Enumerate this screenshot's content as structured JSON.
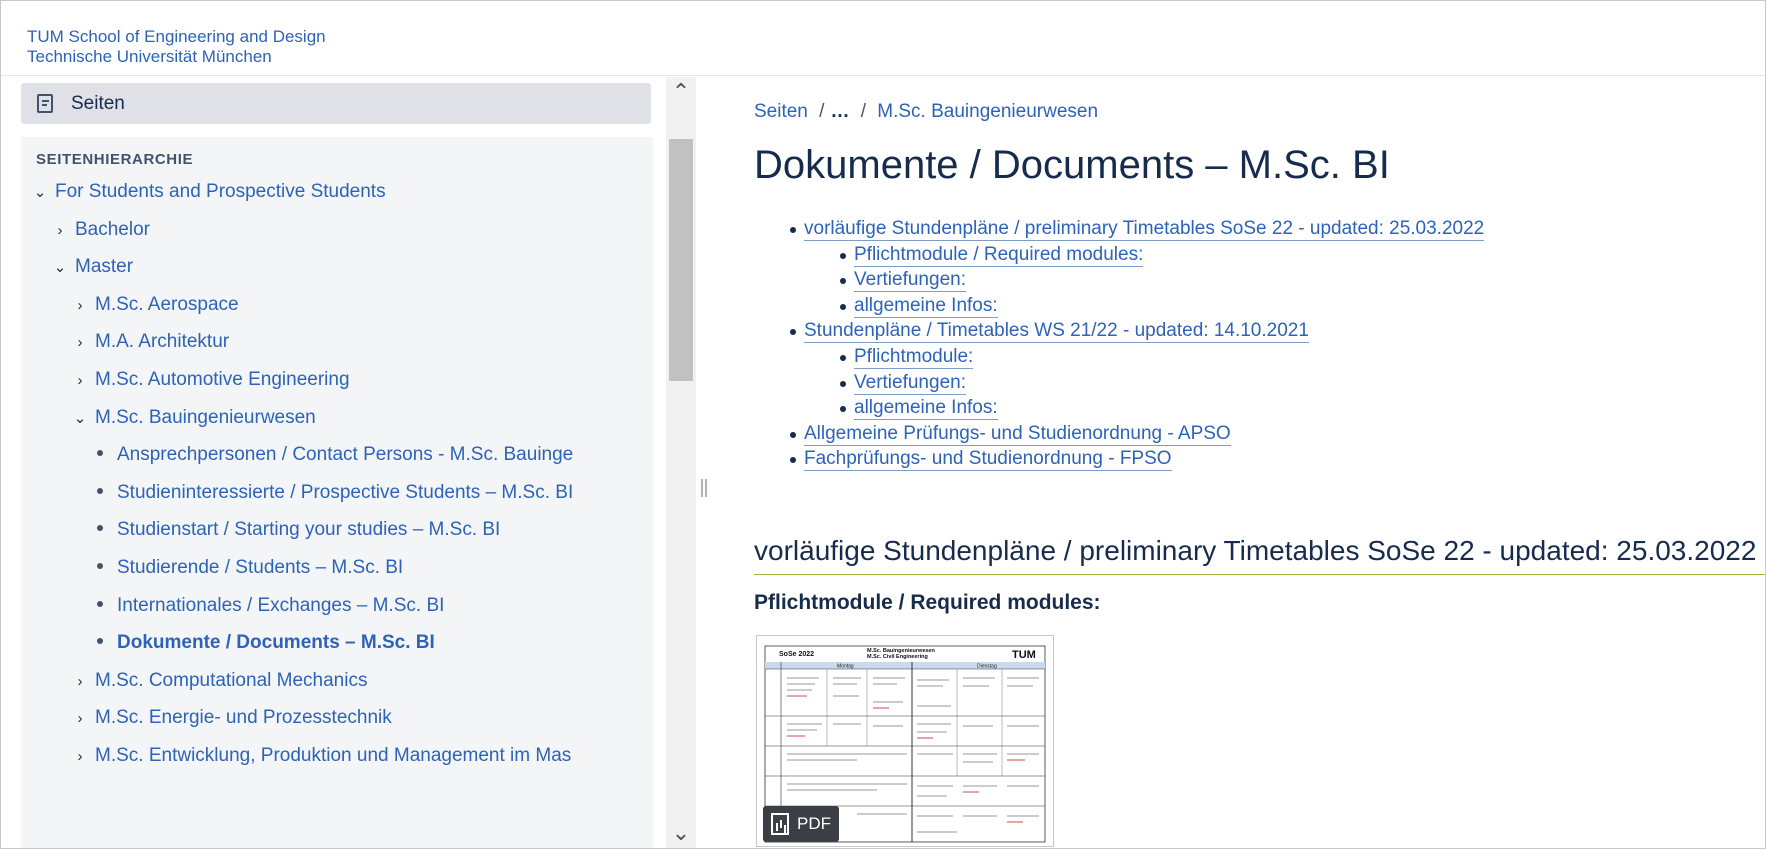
{
  "header": {
    "brand_line1": "TUM School of Engineering and Design",
    "brand_line2": "Technische Universität München"
  },
  "sidebar": {
    "pages_button_label": "Seiten",
    "pages_icon": "page-icon",
    "heading": "SEITENHIERARCHIE",
    "items": [
      {
        "label": "For Students and Prospective Students",
        "toggle": "⌄",
        "level": 0,
        "kind": "expanded"
      },
      {
        "label": "Bachelor",
        "toggle": "›",
        "level": 1,
        "kind": "collapsed"
      },
      {
        "label": "Master",
        "toggle": "⌄",
        "level": 1,
        "kind": "expanded"
      },
      {
        "label": "M.Sc. Aerospace",
        "toggle": "›",
        "level": 2,
        "kind": "collapsed"
      },
      {
        "label": "M.A. Architektur",
        "toggle": "›",
        "level": 2,
        "kind": "collapsed"
      },
      {
        "label": "M.Sc. Automotive Engineering",
        "toggle": "›",
        "level": 2,
        "kind": "collapsed"
      },
      {
        "label": "M.Sc. Bauingenieurwesen",
        "toggle": "⌄",
        "level": 2,
        "kind": "expanded"
      },
      {
        "label": "Ansprechpersonen / Contact Persons - M.Sc. Bauinge",
        "toggle": "",
        "level": 3,
        "kind": "leaf"
      },
      {
        "label": "Studieninteressierte / Prospective Students – M.Sc. BI",
        "toggle": "",
        "level": 3,
        "kind": "leaf"
      },
      {
        "label": "Studienstart / Starting your studies – M.Sc. BI",
        "toggle": "",
        "level": 3,
        "kind": "leaf"
      },
      {
        "label": "Studierende / Students – M.Sc. BI",
        "toggle": "",
        "level": 3,
        "kind": "leaf"
      },
      {
        "label": "Internationales / Exchanges – M.Sc. BI",
        "toggle": "",
        "level": 3,
        "kind": "leaf"
      },
      {
        "label": "Dokumente / Documents – M.Sc. BI",
        "toggle": "",
        "level": 3,
        "kind": "leaf",
        "active": true
      },
      {
        "label": "M.Sc. Computational Mechanics",
        "toggle": "›",
        "level": 2,
        "kind": "collapsed"
      },
      {
        "label": "M.Sc. Energie- und Prozesstechnik",
        "toggle": "›",
        "level": 2,
        "kind": "collapsed"
      },
      {
        "label": "M.Sc. Entwicklung, Produktion und Management im Mas",
        "toggle": "›",
        "level": 2,
        "kind": "collapsed"
      }
    ]
  },
  "scrollbar": {
    "up_icon": "chevron-up-icon",
    "down_icon": "chevron-down-icon",
    "up_glyph": "⌃",
    "down_glyph": "⌄"
  },
  "breadcrumb": {
    "root": "Seiten",
    "separator": "/",
    "ellipsis": "…",
    "parent": "M.Sc. Bauingenieurwesen"
  },
  "page": {
    "title": "Dokumente / Documents – M.Sc. BI",
    "toc": [
      {
        "label": "vorläufige Stundenpläne / preliminary Timetables SoSe 22 - updated: 25.03.2022",
        "level": 0
      },
      {
        "label": "Pflichtmodule / Required modules:",
        "level": 1
      },
      {
        "label": "Vertiefungen:",
        "level": 1
      },
      {
        "label": "allgemeine Infos:",
        "level": 1
      },
      {
        "label": "Stundenpläne / Timetables WS 21/22 - updated: 14.10.2021",
        "level": 0
      },
      {
        "label": "Pflichtmodule:",
        "level": 1
      },
      {
        "label": "Vertiefungen:",
        "level": 1
      },
      {
        "label": "allgemeine Infos:",
        "level": 1
      },
      {
        "label": "Allgemeine Prüfungs- und Studienordnung - APSO",
        "level": 0
      },
      {
        "label": "Fachprüfungs- und Studienordnung - FPSO",
        "level": 0
      }
    ],
    "section_heading": "vorläufige Stundenpläne / preliminary Timetables SoSe 22 - updated: 25.03.2022",
    "subsection_heading": "Pflichtmodule / Required modules:",
    "attachment": {
      "badge_label": "PDF",
      "badge_icon": "pdf-file-icon",
      "semester": "SoSe 2022",
      "program_line1": "M.Sc. Bauingenieurwesen",
      "program_line2": "M.Sc. Civil Engineering",
      "day1": "Montag",
      "day2": "Dienstag",
      "logo": "TUM"
    }
  }
}
